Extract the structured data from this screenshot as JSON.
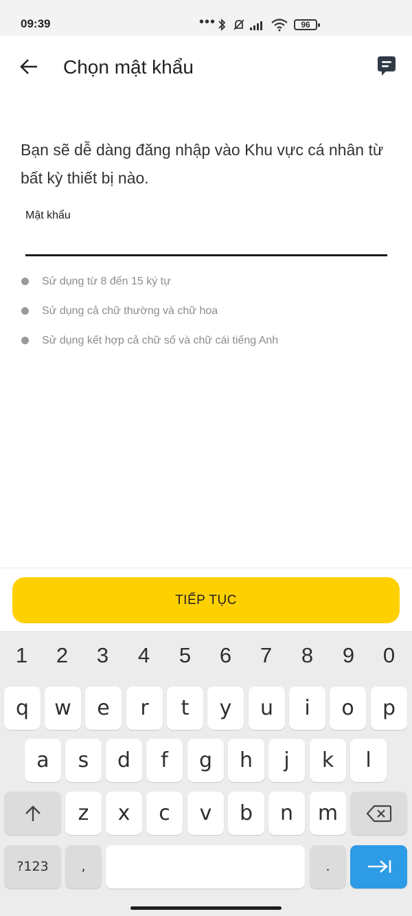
{
  "status_bar": {
    "time": "09:39",
    "dots": "•••",
    "battery": "96"
  },
  "app_bar": {
    "title": "Chọn mật khẩu",
    "back_icon": "arrow-left-icon",
    "chat_icon": "chat-bubble-icon"
  },
  "intro": "Bạn sẽ dễ dàng đăng nhập vào Khu vực cá nhân từ bất kỳ thiết bị nào.",
  "password_field": {
    "label": "Mật khẩu",
    "value": ""
  },
  "rules": [
    "Sử dụng từ 8 đến 15 ký tự",
    "Sử dụng cả chữ thường và chữ hoa",
    "Sử dụng kết hợp cả chữ số và chữ cái tiếng Anh"
  ],
  "continue_label": "TIẾP TỤC",
  "keyboard": {
    "numbers": [
      "1",
      "2",
      "3",
      "4",
      "5",
      "6",
      "7",
      "8",
      "9",
      "0"
    ],
    "row1": [
      "q",
      "w",
      "e",
      "r",
      "t",
      "y",
      "u",
      "i",
      "o",
      "p"
    ],
    "row2": [
      "a",
      "s",
      "d",
      "f",
      "g",
      "h",
      "j",
      "k",
      "l"
    ],
    "row3": [
      "z",
      "x",
      "c",
      "v",
      "b",
      "n",
      "m"
    ],
    "shift": "↑",
    "backspace": "⌫",
    "symbols": "?123",
    "comma": ",",
    "period": ".",
    "enter": "⇥"
  },
  "colors": {
    "accent": "#ffd000",
    "enter_key": "#2e9be6"
  }
}
